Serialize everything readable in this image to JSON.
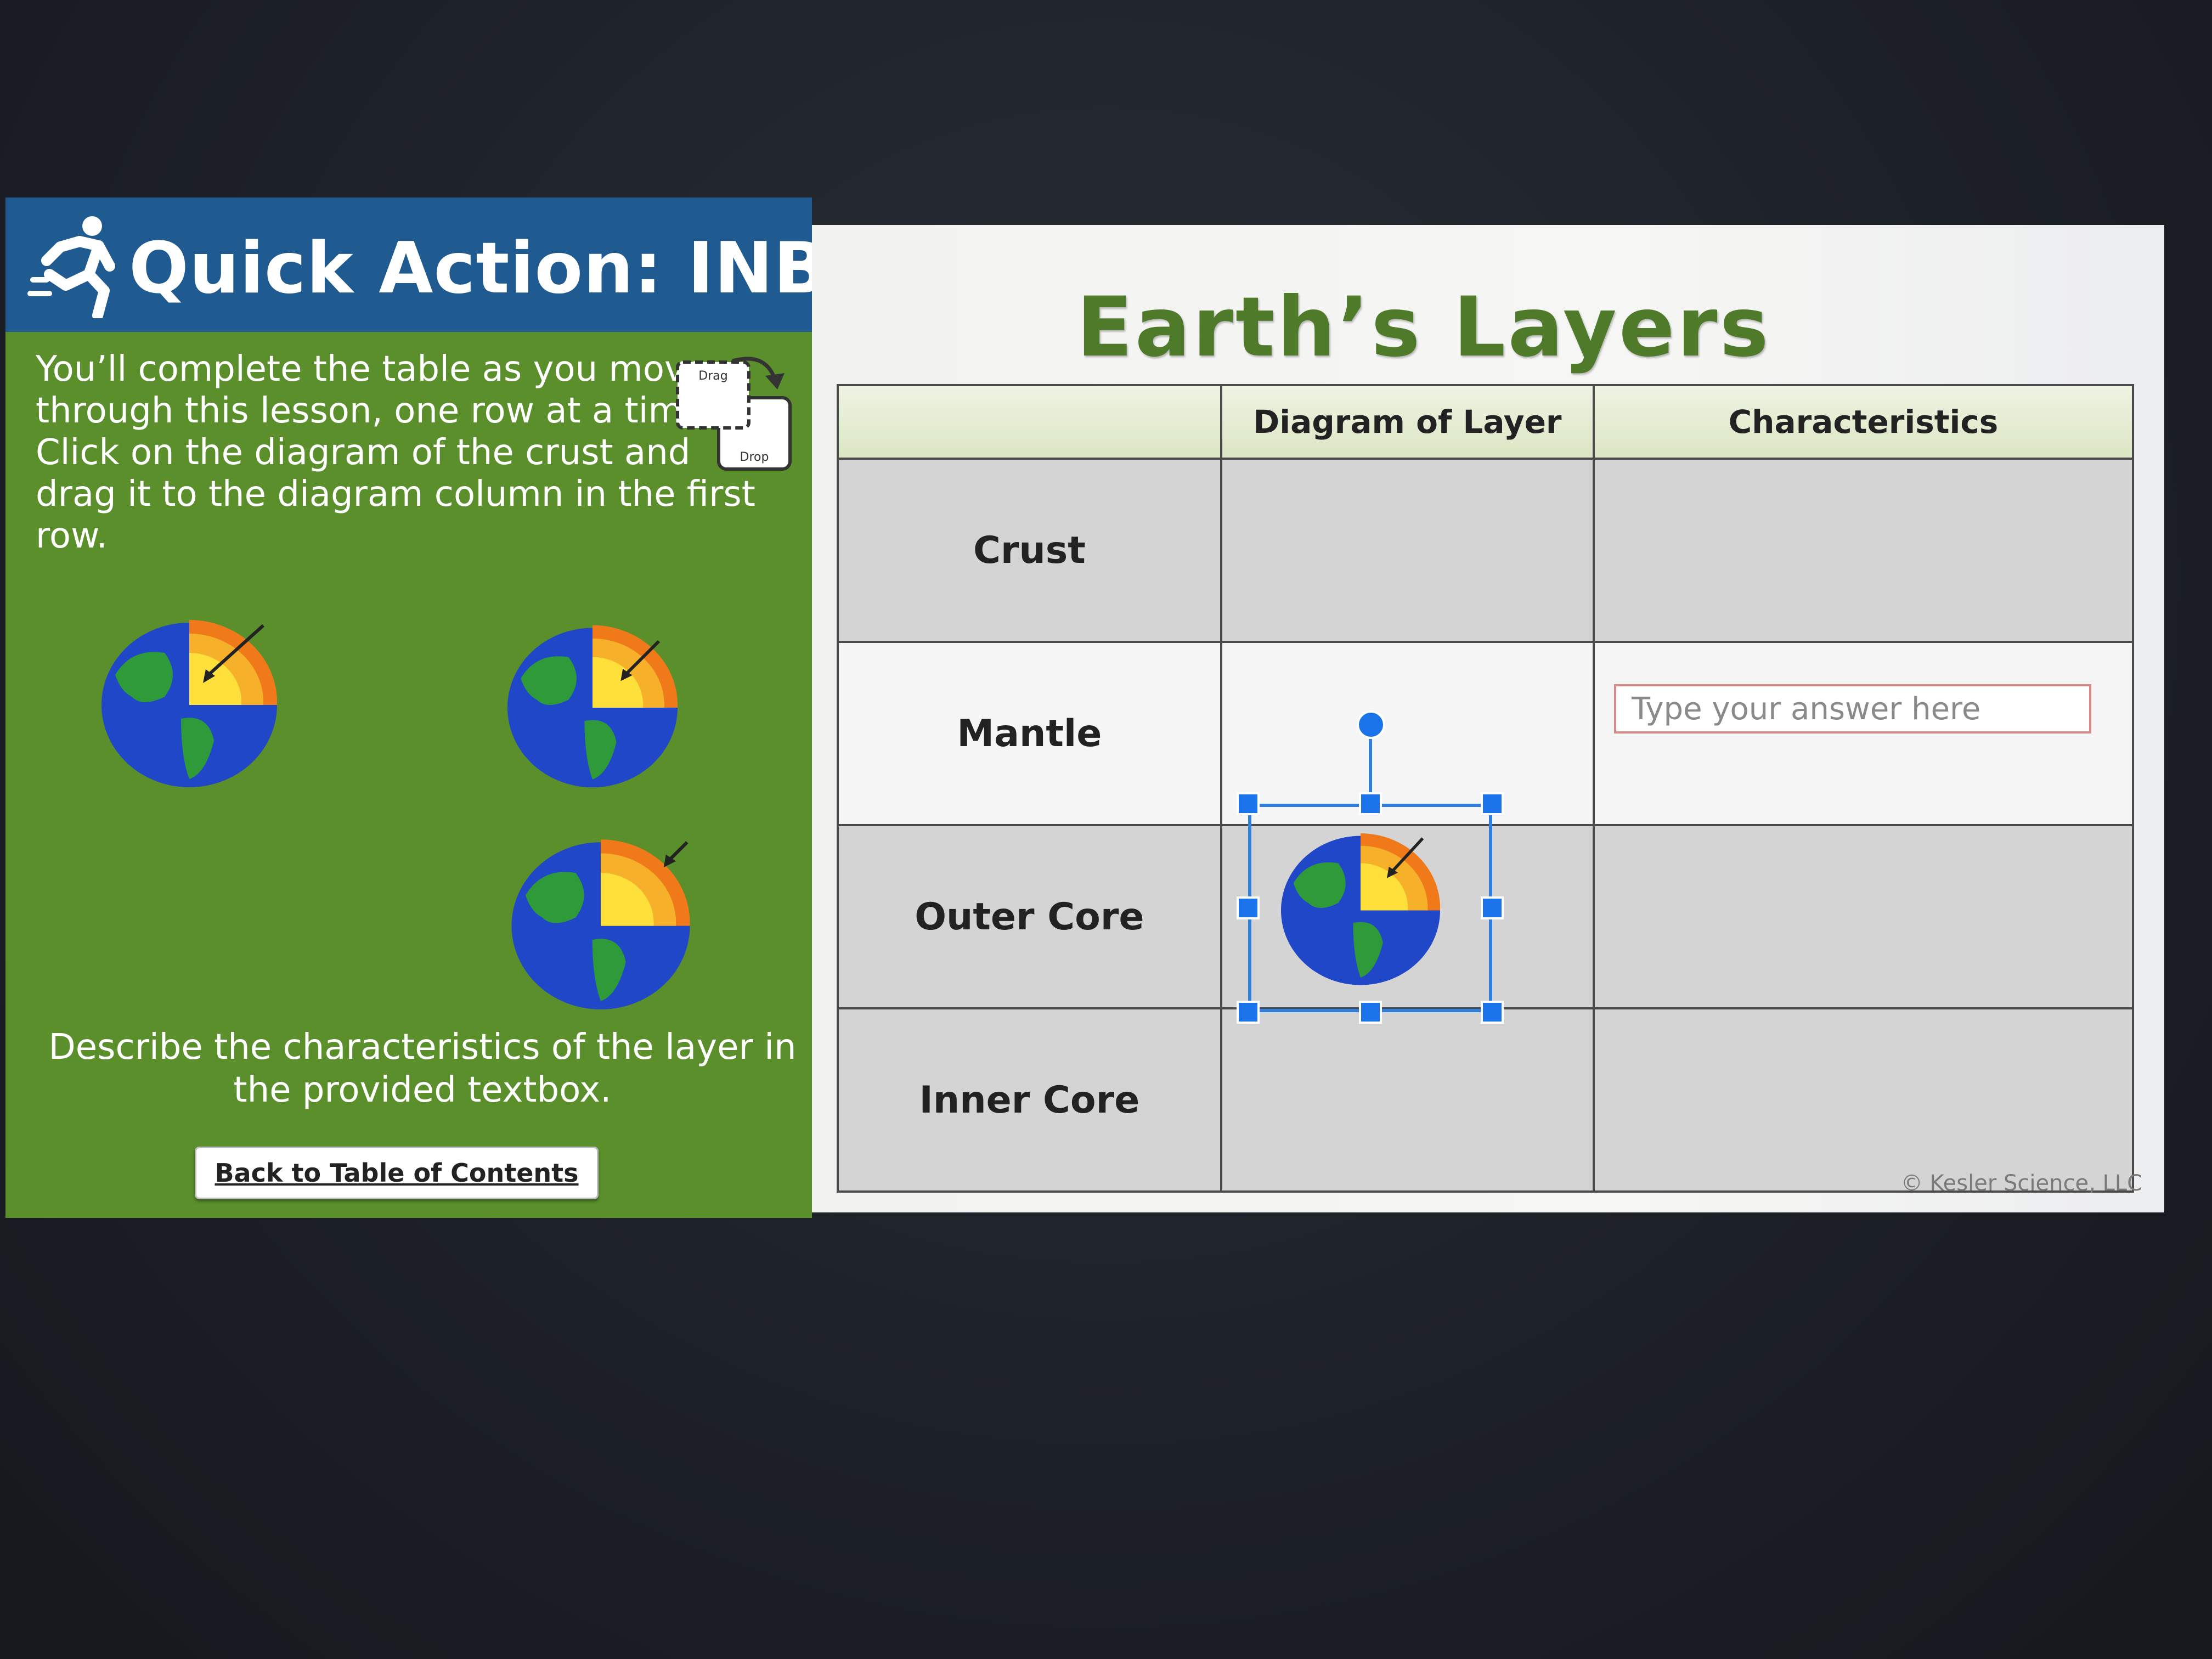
{
  "left_panel": {
    "header_title": "Quick Action: INB",
    "instructions": "You’ll complete the table as you move through this lesson, one row at a time. Click on the diagram of the crust and drag it to the diagram column in the first row.",
    "drag_label": "Drag",
    "drop_label": "Drop",
    "describe_text": "Describe the characteristics of the layer in the provided textbox.",
    "back_button_label": "Back to Table of Contents",
    "colors": {
      "header_bg": "#1f5a91",
      "panel_bg": "#5b8f2c"
    }
  },
  "main": {
    "title": "Earth’s Layers",
    "table": {
      "headers": [
        "",
        "Diagram of Layer",
        "Characteristics"
      ],
      "rows": [
        {
          "label": "Crust"
        },
        {
          "label": "Mantle"
        },
        {
          "label": "Outer Core"
        },
        {
          "label": "Inner Core"
        }
      ]
    },
    "answer_placeholder": "Type your answer here",
    "copyright": "© Kesler Science, LLC",
    "colors": {
      "title": "#4e7a2a",
      "selection": "#1a73e8"
    }
  }
}
